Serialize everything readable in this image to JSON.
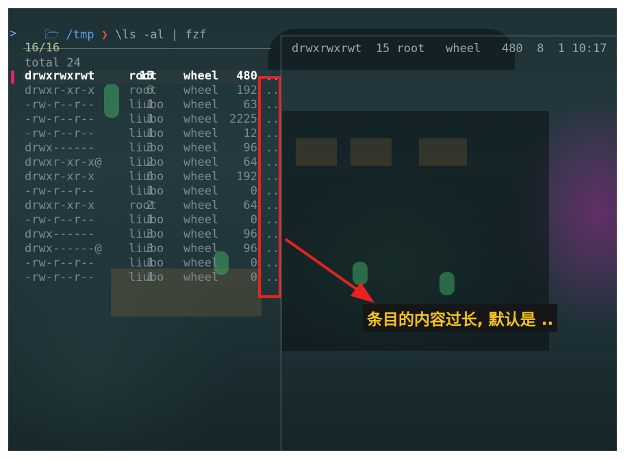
{
  "prompt": {
    "apple_icon": "apple-icon",
    "folder_icon": "folder-icon",
    "path": "/tmp",
    "arrow": "❯",
    "command": "\\ls -al | fzf",
    "caret": ">"
  },
  "finder": {
    "counter": "16/16",
    "header": "total 24",
    "rows": [
      {
        "perm": "drwxrwxrwt",
        "links": "15",
        "owner": "root",
        "group": "wheel",
        "size": "480",
        "tail": ".."
      },
      {
        "perm": "drwxr-xr-x",
        "links": "6",
        "owner": "root",
        "group": "wheel",
        "size": "192",
        "tail": ".."
      },
      {
        "perm": "-rw-r--r--",
        "links": "1",
        "owner": "liubo",
        "group": "wheel",
        "size": "63",
        "tail": ".."
      },
      {
        "perm": "-rw-r--r--",
        "links": "1",
        "owner": "liubo",
        "group": "wheel",
        "size": "2225",
        "tail": ".."
      },
      {
        "perm": "-rw-r--r--",
        "links": "1",
        "owner": "liubo",
        "group": "wheel",
        "size": "12",
        "tail": ".."
      },
      {
        "perm": "drwx------",
        "links": "3",
        "owner": "liubo",
        "group": "wheel",
        "size": "96",
        "tail": ".."
      },
      {
        "perm": "drwxr-xr-x@",
        "links": "2",
        "owner": "liubo",
        "group": "wheel",
        "size": "64",
        "tail": ".."
      },
      {
        "perm": "drwxr-xr-x",
        "links": "6",
        "owner": "liubo",
        "group": "wheel",
        "size": "192",
        "tail": ".."
      },
      {
        "perm": "-rw-r--r--",
        "links": "1",
        "owner": "liubo",
        "group": "wheel",
        "size": "0",
        "tail": ".."
      },
      {
        "perm": "drwxr-xr-x",
        "links": "2",
        "owner": "root",
        "group": "wheel",
        "size": "64",
        "tail": ".."
      },
      {
        "perm": "-rw-r--r--",
        "links": "1",
        "owner": "liubo",
        "group": "wheel",
        "size": "0",
        "tail": ".."
      },
      {
        "perm": "drwx------",
        "links": "3",
        "owner": "liubo",
        "group": "wheel",
        "size": "96",
        "tail": ".."
      },
      {
        "perm": "drwx------@",
        "links": "3",
        "owner": "liubo",
        "group": "wheel",
        "size": "96",
        "tail": ".."
      },
      {
        "perm": "-rw-r--r--",
        "links": "1",
        "owner": "liubo",
        "group": "wheel",
        "size": "0",
        "tail": ".."
      },
      {
        "perm": "-rw-r--r--",
        "links": "1",
        "owner": "liubo",
        "group": "wheel",
        "size": "0",
        "tail": ".."
      }
    ]
  },
  "preview": {
    "text": "drwxrwxrwt  15 root   wheel   480  8  1 10:17 ."
  },
  "annotation": {
    "label": "条目的内容过长, 默认是 ..",
    "color": "#e8221c"
  },
  "colors": {
    "selected_marker": "#e0246f",
    "counter": "#b7c78a",
    "label_text": "#f5c518"
  }
}
